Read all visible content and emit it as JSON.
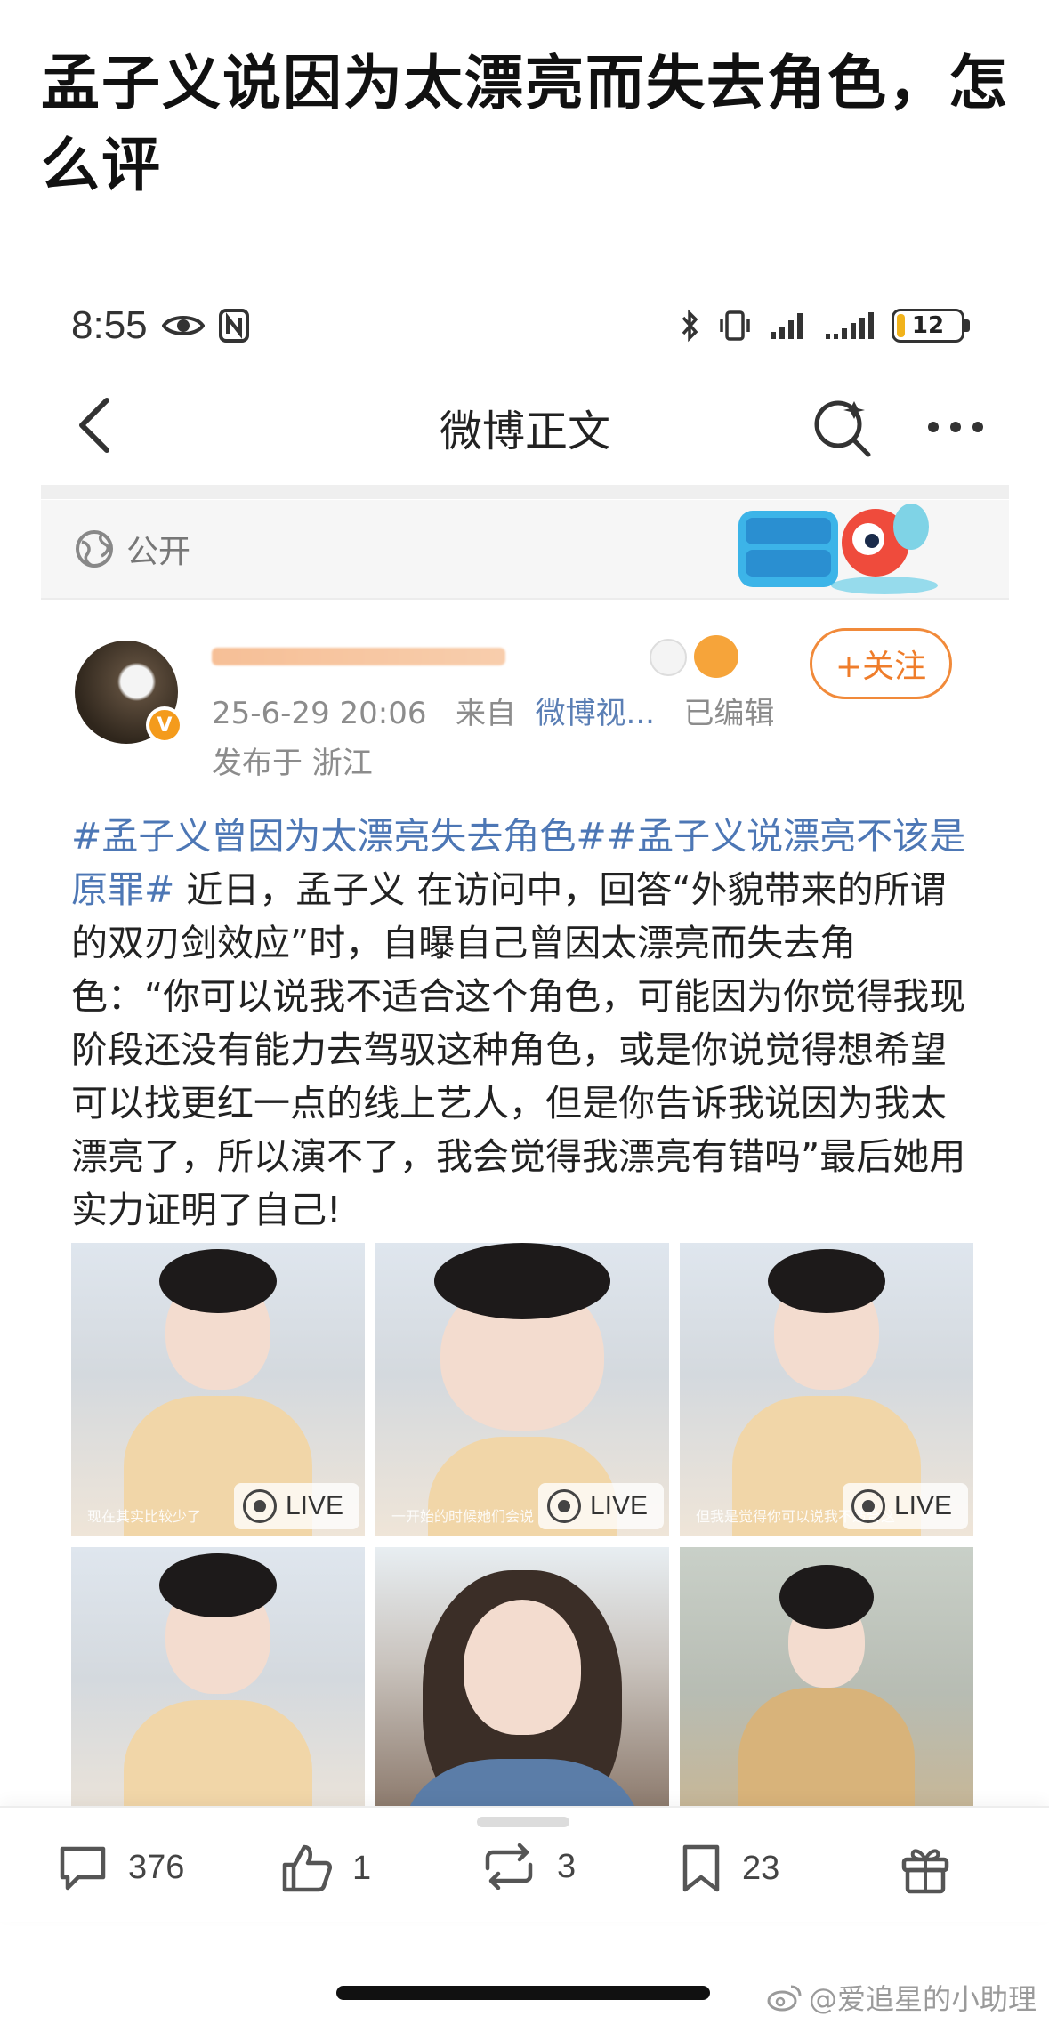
{
  "question": {
    "title": "孟子义说因为太漂亮而失去角色，怎么评"
  },
  "status_bar": {
    "time": "8:55",
    "battery": "12"
  },
  "nav": {
    "title": "微博正文"
  },
  "visibility": {
    "label": "公开"
  },
  "post": {
    "date": "25-6-29 20:06",
    "source_prefix": "来自",
    "source": "微博视...",
    "edited": "已编辑",
    "location": "发布于 浙江",
    "follow_label": "+关注",
    "hashtag1": "#孟子义曾因为太漂亮失去角色#",
    "hashtag2": "#孟子义说漂亮不该是原罪#",
    "body": " 近日，孟子义 在访问中，回答“外貌带来的所谓的双刃剑效应”时，自曝自己曾因太漂亮而失去角色：“你可以说我不适合这个角色，可能因为你觉得我现阶段还没有能力去驾驭这种角色，或是你说觉得想希望可以找更红一点的线上艺人，但是你告诉我说因为我太漂亮了，所以演不了，我会觉得我漂亮有错吗”最后她用实力证明了自己!"
  },
  "photos": {
    "live_label": "LIVE",
    "captions": [
      "现在其实比较少了",
      "一开始的时候她们会说",
      "但我是觉得你可以说我不适合这"
    ]
  },
  "actions": {
    "comments": "376",
    "likes": "1",
    "reposts": "3",
    "favorites": "23"
  },
  "watermark": "@爱追星的小助理",
  "colors": {
    "accent_orange": "#ef7d2b",
    "link_blue": "#4d77b5",
    "meta_gray": "#8c8c8c"
  }
}
